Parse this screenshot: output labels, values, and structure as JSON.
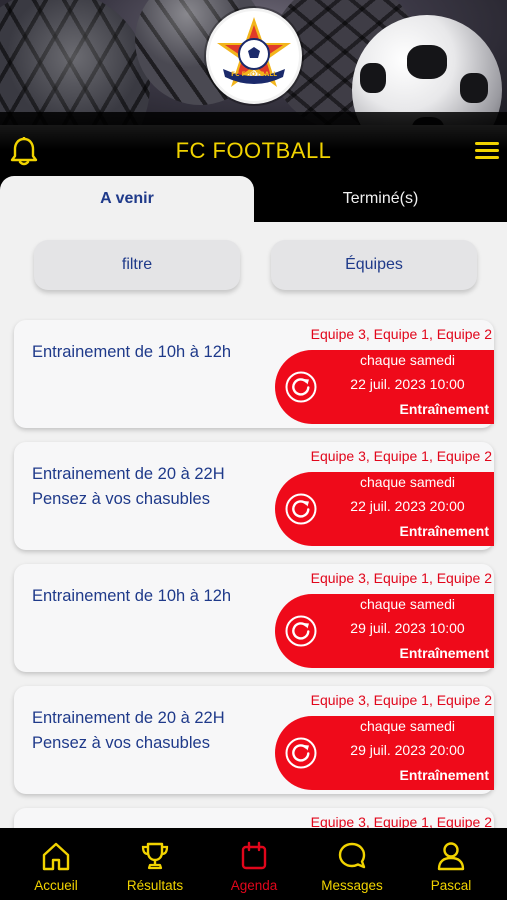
{
  "header": {
    "title": "FC FOOTBALL",
    "logo_text": "FC FOOTBALL",
    "bell_icon": "bell-icon",
    "menu_icon": "hamburger-menu-icon"
  },
  "tabs": [
    {
      "label": "A venir",
      "active": true
    },
    {
      "label": "Terminé(s)",
      "active": false
    }
  ],
  "filters": {
    "filter_label": "filtre",
    "teams_label": "Équipes"
  },
  "events": [
    {
      "title_lines": [
        "Entrainement de 10h à 12h"
      ],
      "teams": "Equipe 3, Equipe 1, Equipe 2",
      "recurrence": "chaque samedi",
      "datetime": "22 juil. 2023 10:00",
      "type": "Entraînement"
    },
    {
      "title_lines": [
        "Entrainement de 20 à 22H",
        "Pensez à vos chasubles"
      ],
      "teams": "Equipe 3, Equipe 1, Equipe 2",
      "recurrence": "chaque samedi",
      "datetime": "22 juil. 2023 20:00",
      "type": "Entraînement"
    },
    {
      "title_lines": [
        "Entrainement de 10h à 12h"
      ],
      "teams": "Equipe 3, Equipe 1, Equipe 2",
      "recurrence": "chaque samedi",
      "datetime": "29 juil. 2023 10:00",
      "type": "Entraînement"
    },
    {
      "title_lines": [
        "Entrainement de 20 à 22H",
        "Pensez à vos chasubles"
      ],
      "teams": "Equipe 3, Equipe 1, Equipe 2",
      "recurrence": "chaque samedi",
      "datetime": "29 juil. 2023 20:00",
      "type": "Entraînement"
    },
    {
      "title_lines": [
        ""
      ],
      "teams": "Equipe 3, Equipe 1, Equipe 2",
      "recurrence": "",
      "datetime": "",
      "type": ""
    }
  ],
  "bottom_nav": [
    {
      "label": "Accueil",
      "icon": "home-icon",
      "active": false
    },
    {
      "label": "Résultats",
      "icon": "trophy-icon",
      "active": false
    },
    {
      "label": "Agenda",
      "icon": "calendar-icon",
      "active": true
    },
    {
      "label": "Messages",
      "icon": "message-icon",
      "active": false
    },
    {
      "label": "Pascal",
      "icon": "user-icon",
      "active": false
    }
  ],
  "colors": {
    "accent_yellow": "#f1d300",
    "brand_blue": "#1f3a8a",
    "event_red": "#ef0a1a",
    "background": "#f1f1f1",
    "bar_black": "#000000"
  }
}
